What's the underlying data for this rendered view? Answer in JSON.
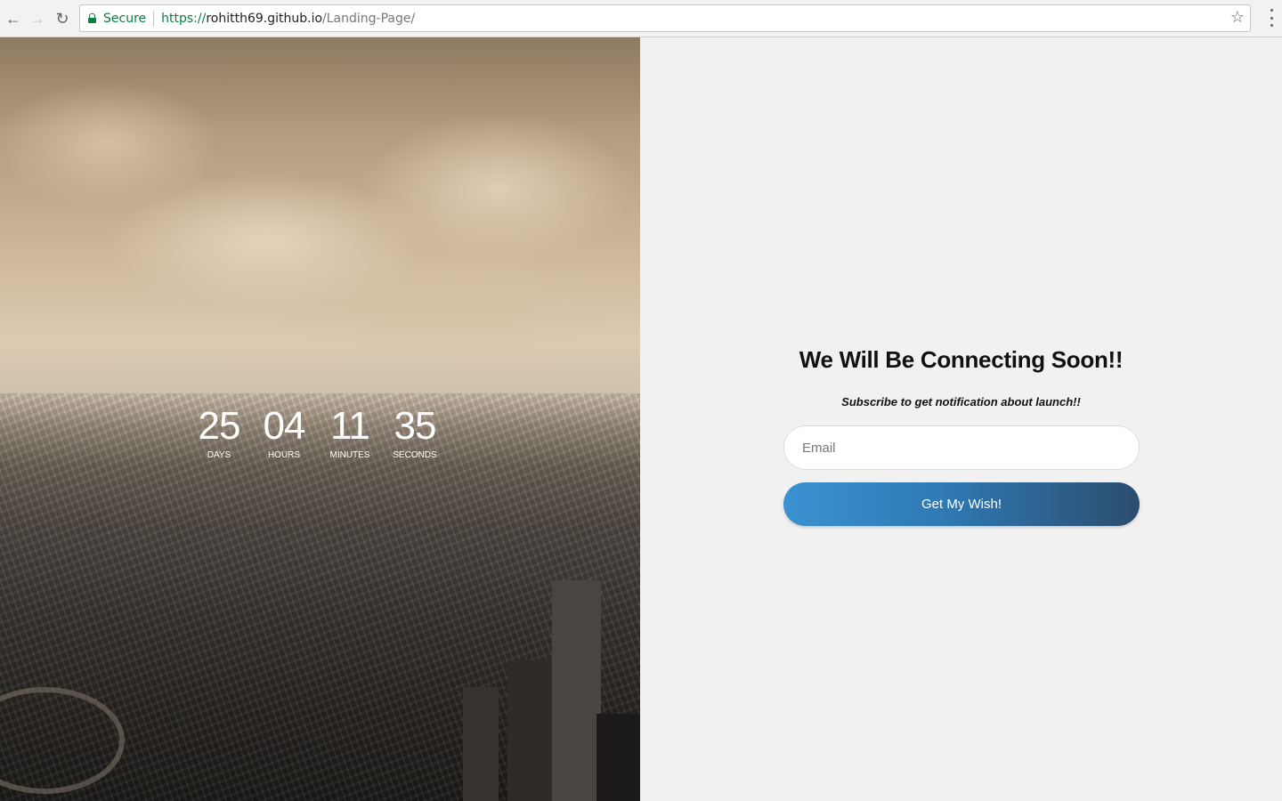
{
  "browser": {
    "secure_label": "Secure",
    "url_scheme": "https://",
    "url_host": "rohitth69.github.io",
    "url_path": "/Landing-Page/",
    "icons": {
      "back": "back-arrow-icon",
      "forward": "forward-arrow-icon",
      "reload": "reload-icon",
      "lock": "lock-icon",
      "bookmark": "star-icon",
      "menu": "kebab-menu-icon"
    },
    "secure_color": "#0b8043"
  },
  "countdown": {
    "days": {
      "value": "25",
      "label": "DAYS"
    },
    "hours": {
      "value": "04",
      "label": "HOURS"
    },
    "minutes": {
      "value": "11",
      "label": "MINUTES"
    },
    "seconds": {
      "value": "35",
      "label": "SECONDS"
    }
  },
  "signup": {
    "headline": "We Will Be Connecting Soon!!",
    "subline": "Subscribe to get notification about launch!!",
    "email_placeholder": "Email",
    "email_value": "",
    "button_label": "Get My Wish!",
    "button_gradient": [
      "#3a92d0",
      "#2c4d6e"
    ]
  }
}
